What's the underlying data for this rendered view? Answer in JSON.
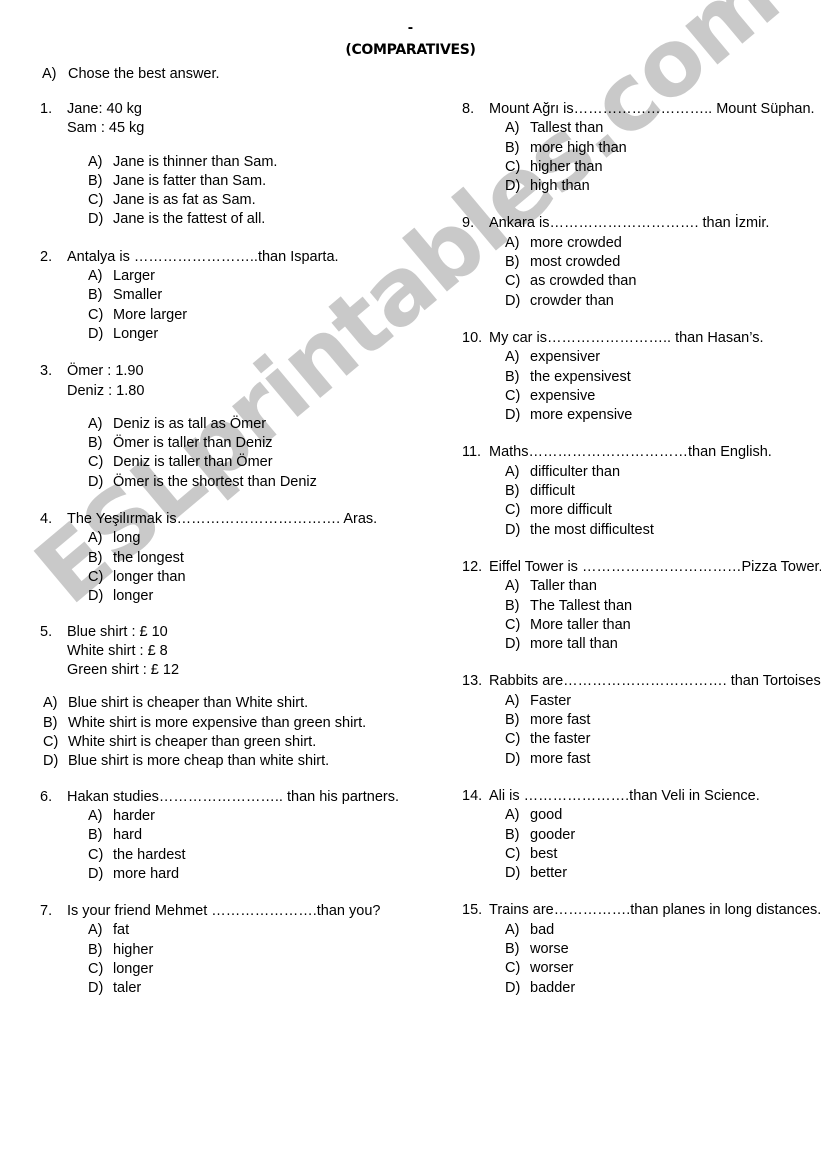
{
  "header": {
    "dash": "-",
    "title": "(COMPARATIVES)",
    "instruction_label": "A)",
    "instruction_text": "Chose the best answer."
  },
  "watermark": "ESLprintables.com",
  "option_labels": [
    "A)",
    "B)",
    "C)",
    "D)"
  ],
  "left_column": [
    {
      "number": "1.",
      "stem": "Jane: 40 kg",
      "extra_lines": [
        "Sam : 45 kg"
      ],
      "options": [
        "Jane is thinner than Sam.",
        "Jane is fatter than Sam.",
        "Jane is as fat as Sam.",
        "Jane is the fattest of all."
      ]
    },
    {
      "number": "2.",
      "stem": "Antalya is ……………………..than  Isparta.",
      "extra_lines": [],
      "options": [
        "Larger",
        "Smaller",
        "More larger",
        "Longer"
      ]
    },
    {
      "number": "3.",
      "stem": "Ömer : 1.90",
      "extra_lines": [
        "Deniz : 1.80"
      ],
      "options": [
        "Deniz is as tall as Ömer",
        "Ömer is taller than Deniz",
        "Deniz is taller than Ömer",
        "Ömer is the shortest than Deniz"
      ]
    },
    {
      "number": "4.",
      "stem": "The Yeşilırmak is…………………………….  Aras.",
      "extra_lines": [],
      "options": [
        "long",
        "the longest",
        "longer than",
        "longer"
      ]
    },
    {
      "number": "5.",
      "stem": "Blue shirt    : £ 10",
      "extra_lines": [
        "White shirt : £ 8",
        "Green shirt : £ 12"
      ],
      "options": [
        "Blue shirt is cheaper than White shirt.",
        "White shirt is more expensive than green shirt.",
        "White shirt is cheaper than green shirt.",
        "Blue shirt is more cheap than white shirt."
      ]
    },
    {
      "number": "6.",
      "stem": "Hakan studies…………………….. than his partners.",
      "extra_lines": [],
      "options": [
        "harder",
        "hard",
        "the hardest",
        "more hard"
      ]
    },
    {
      "number": "7.",
      "stem": "Is your friend Mehmet ………………….than you?",
      "extra_lines": [],
      "options": [
        "fat",
        "higher",
        "longer",
        "taler"
      ]
    }
  ],
  "right_column": [
    {
      "number": "8.",
      "stem": "Mount  Ağrı is……………………….. Mount Süphan.",
      "extra_lines": [],
      "options": [
        "Tallest than",
        "more high than",
        "higher than",
        "high than"
      ]
    },
    {
      "number": "9.",
      "stem": "Ankara is…………………………. than İzmir.",
      "extra_lines": [],
      "options": [
        "more crowded",
        "most crowded",
        "as crowded than",
        "crowder than"
      ]
    },
    {
      "number": "10.",
      "stem": "My car is…………………….. than Hasan’s.",
      "extra_lines": [],
      "options": [
        "expensiver",
        "the expensivest",
        "expensive",
        "more expensive"
      ]
    },
    {
      "number": "11.",
      "stem": "Maths……………………………than  English.",
      "extra_lines": [],
      "options": [
        "difficulter than",
        "difficult",
        "more difficult",
        "the most difficultest"
      ]
    },
    {
      "number": "12.",
      "stem": "Eiffel Tower is ……………………………Pizza Tower.",
      "extra_lines": [],
      "options": [
        "Taller than",
        "The Tallest than",
        "More taller than",
        "more tall than"
      ]
    },
    {
      "number": "13.",
      "stem": "Rabbits are……………………………. than  Tortoises.",
      "extra_lines": [],
      "options": [
        "Faster",
        "more fast",
        "the faster",
        "more fast"
      ]
    },
    {
      "number": "14.",
      "stem": "Ali is ………………….than Veli in Science.",
      "extra_lines": [],
      "options": [
        "good",
        "gooder",
        "best",
        "better"
      ]
    },
    {
      "number": "15.",
      "stem": "Trains are…………….than planes in long distances.",
      "extra_lines": [],
      "options": [
        "bad",
        "worse",
        "worser",
        "badder"
      ]
    }
  ]
}
